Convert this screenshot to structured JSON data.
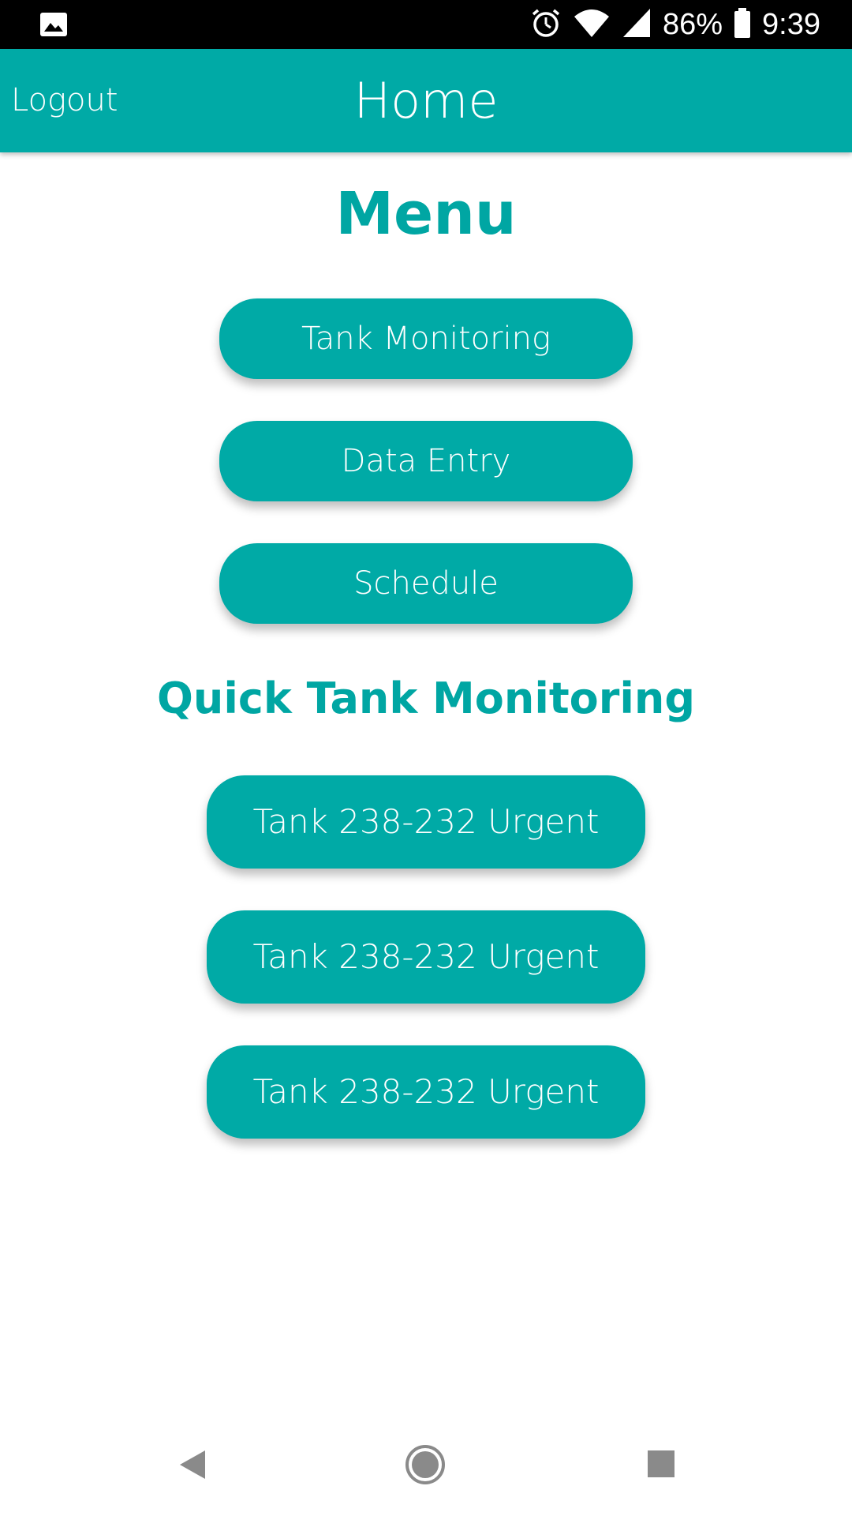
{
  "status_bar": {
    "left_icon": "image-icon",
    "icons": [
      "alarm-icon",
      "wifi-icon",
      "cell-signal-icon"
    ],
    "battery_percent": "86%",
    "battery_icon": "battery-icon",
    "time": "9:39"
  },
  "app_bar": {
    "logout_label": "Logout",
    "title": "Home"
  },
  "menu": {
    "heading": "Menu",
    "buttons": [
      "Tank Monitoring",
      "Data Entry",
      "Schedule"
    ]
  },
  "quick": {
    "heading": "Quick Tank Monitoring",
    "buttons": [
      "Tank 238-232 Urgent",
      "Tank 238-232 Urgent",
      "Tank 238-232 Urgent"
    ]
  },
  "nav_bar": {
    "icons": [
      "back-icon",
      "home-icon",
      "recents-icon"
    ]
  },
  "colors": {
    "primary": "#00aaa6",
    "heading": "#00a6a3",
    "status_bar": "#000000",
    "nav_icon": "#8a8a8a"
  }
}
